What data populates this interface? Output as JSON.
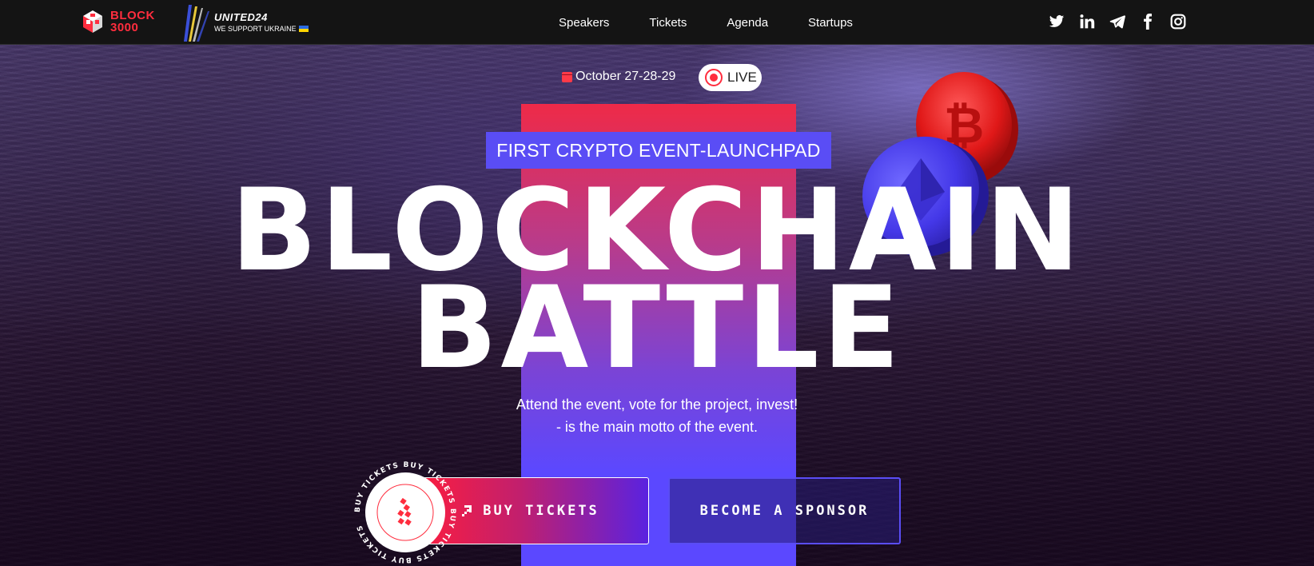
{
  "brand": {
    "logo_line1": "BLOCK",
    "logo_line2": "3000"
  },
  "partner": {
    "title": "UNITED24",
    "subtitle": "WE SUPPORT UKRAINE"
  },
  "nav": {
    "items": [
      "Speakers",
      "Tickets",
      "Agenda",
      "Startups"
    ]
  },
  "socials": [
    "twitter-icon",
    "linkedin-icon",
    "telegram-icon",
    "facebook-icon",
    "instagram-icon"
  ],
  "hero": {
    "date": "October 27-28-29",
    "live_label": "LIVE",
    "badge": "FIRST CRYPTO EVENT-LAUNCHPAD",
    "title_line1": "BLOCKCHAIN",
    "title_line2": "BATTLE",
    "motto_line1": "Attend the event, vote for the project, invest!",
    "motto_line2": "- is the main motto of the event.",
    "buy_tickets_label": "BUY TICKETS",
    "become_sponsor_label": "BECOME A SPONSOR",
    "seal_text": "BUY TICKETS  BUY TICKETS  BUY TICKETS  BUY TICKETS"
  },
  "colors": {
    "accent_red": "#ff2d3e",
    "accent_blue": "#5a4df5",
    "header_bg": "#141414"
  }
}
